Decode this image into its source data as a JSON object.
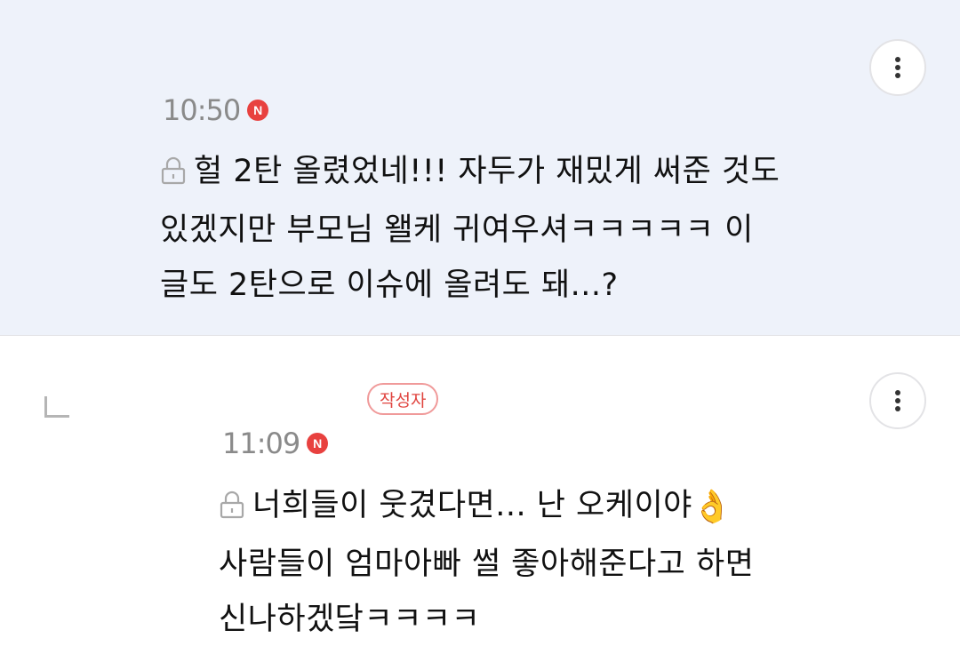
{
  "comments": [
    {
      "time": "10:50",
      "new_badge": "N",
      "text_lines": [
        "헐 2탄 올렸었네!!! 자두가 재밌게 써준 것도",
        "있겠지만 부모님 왤케 귀여우셔ㅋㅋㅋㅋㅋ 이",
        "글도 2탄으로 이슈에 올려도 돼...?"
      ]
    },
    {
      "author_badge": "작성자",
      "time": "11:09",
      "new_badge": "N",
      "text_lines": [
        "너희들이 웃겼다면... 난 오케이야",
        "사람들이 엄마아빠 썰 좋아해준다고 하면",
        "신나하겠닼ㅋㅋㅋㅋ"
      ],
      "emoji": "👌"
    }
  ],
  "icons": {
    "more": "more-vertical-icon",
    "lock": "lock-icon",
    "reply": "reply-corner-icon"
  },
  "colors": {
    "highlight_bg": "#eef2fa",
    "new_badge": "#e8413f",
    "author_badge_text": "#e0443f",
    "author_badge_border": "#f09a9a",
    "time_text": "#8a8a8a"
  }
}
